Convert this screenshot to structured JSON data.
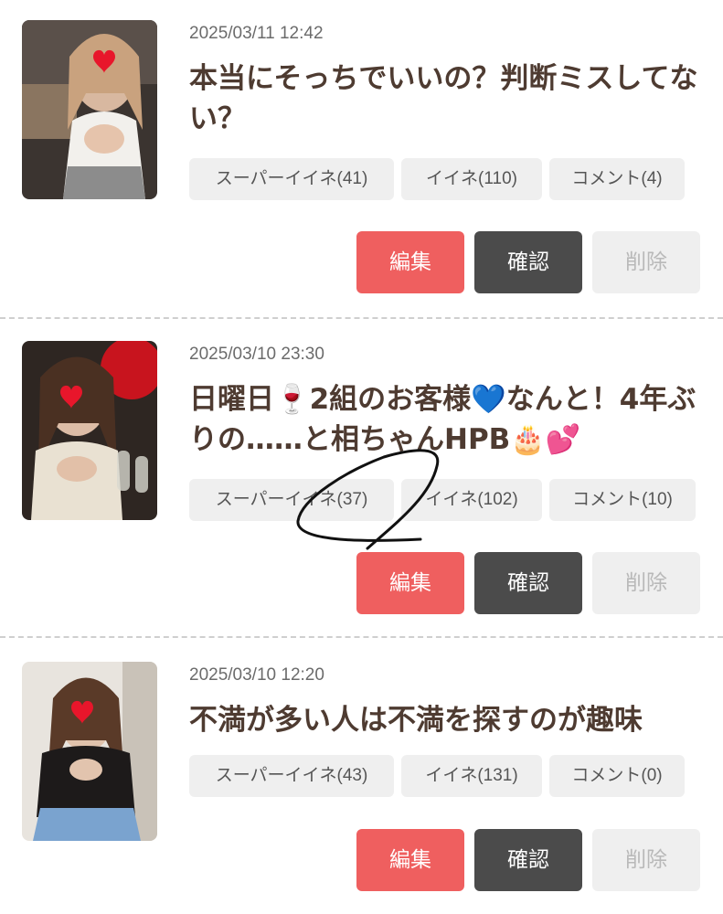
{
  "posts": [
    {
      "date": "2025/03/11 12:42",
      "title": "本当にそっちでいいの？判断ミスしてない？",
      "tags": {
        "super": "スーパーイイネ(41)",
        "iine": "イイネ(110)",
        "comment": "コメント(4)"
      },
      "buttons": {
        "edit": "編集",
        "confirm": "確認",
        "delete": "削除"
      }
    },
    {
      "date": "2025/03/10 23:30",
      "title_parts": [
        "日曜日",
        "🍷",
        "2組のお客様",
        "💙",
        "なんと！4年ぶりの……と相ちゃんHPB",
        "🎂",
        "💕"
      ],
      "tags": {
        "super": "スーパーイイネ(37)",
        "iine": "イイネ(102)",
        "comment": "コメント(10)"
      },
      "buttons": {
        "edit": "編集",
        "confirm": "確認",
        "delete": "削除"
      }
    },
    {
      "date": "2025/03/10 12:20",
      "title": "不満が多い人は不満を探すのが趣味",
      "tags": {
        "super": "スーパーイイネ(43)",
        "iine": "イイネ(131)",
        "comment": "コメント(0)"
      },
      "buttons": {
        "edit": "編集",
        "confirm": "確認",
        "delete": "削除"
      }
    }
  ],
  "colors": {
    "edit": "#ef5f5f",
    "confirm": "#4b4b4b",
    "delete": "#efefef",
    "tag": "#efefef",
    "title": "#4e3b31"
  }
}
